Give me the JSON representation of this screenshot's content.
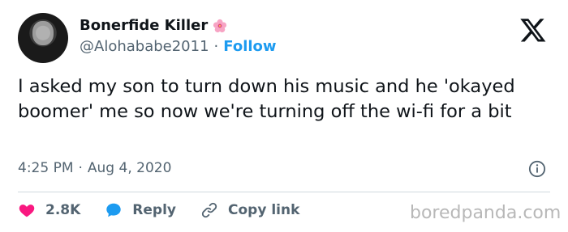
{
  "author": {
    "name": "Bonerfide Killer",
    "handle": "@Alohababe2011",
    "separator": "·",
    "follow_label": "Follow",
    "name_emoji_icon": "hibiscus-icon"
  },
  "platform_icon": "x-logo-icon",
  "tweet": {
    "text": "I asked my son to turn down his music and he 'okayed boomer' me so now we're turning off the wi-fi for a bit"
  },
  "meta": {
    "time": "4:25 PM",
    "separator": "·",
    "date": "Aug 4, 2020",
    "info_icon": "info-icon"
  },
  "actions": {
    "likes_count": "2.8K",
    "reply_label": "Reply",
    "copy_link_label": "Copy link"
  },
  "watermark": "boredpanda.com",
  "colors": {
    "accent": "#1d9bf0",
    "like": "#f91880",
    "muted": "#536471"
  }
}
